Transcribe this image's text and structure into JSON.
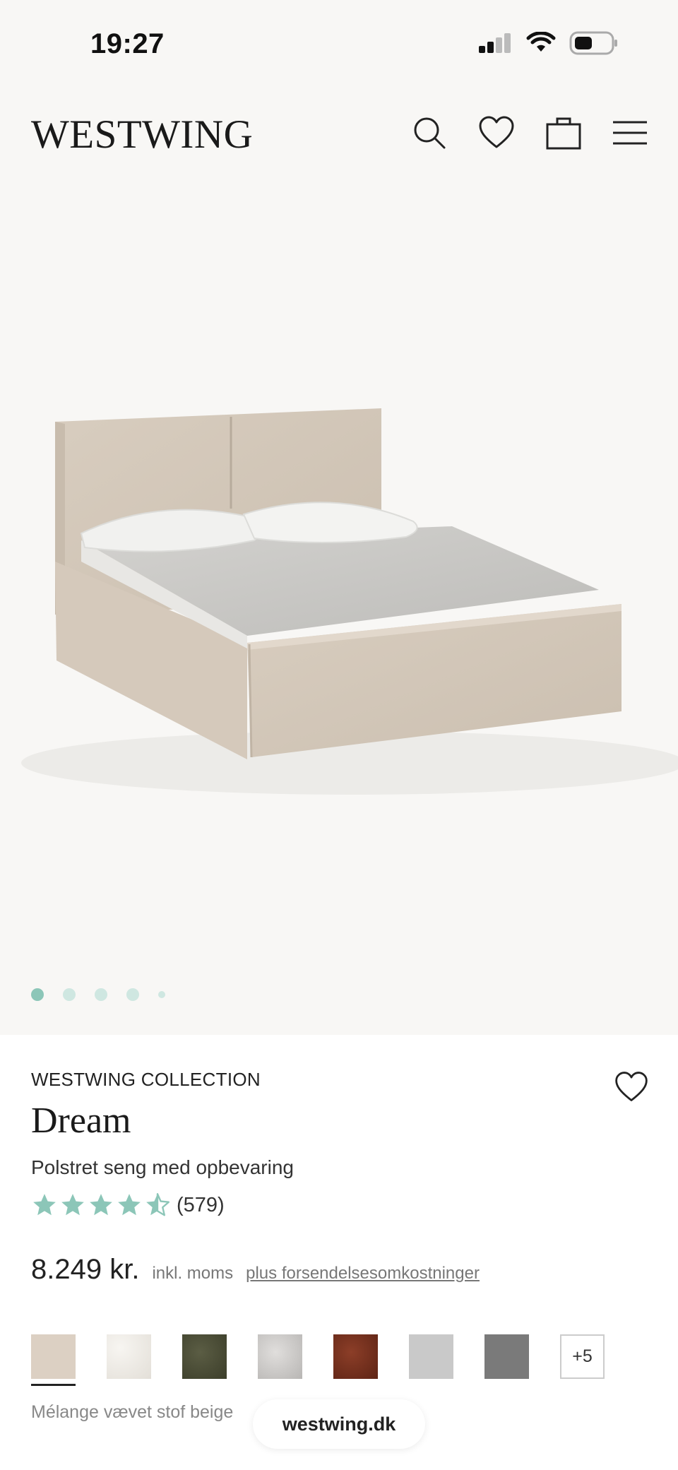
{
  "status": {
    "time": "19:27"
  },
  "header": {
    "logo": "WESTWING"
  },
  "gallery": {
    "dot_count": 5,
    "active_index": 0
  },
  "product": {
    "brand": "WESTWING COLLECTION",
    "name": "Dream",
    "subtitle": "Polstret seng med opbevaring",
    "rating": {
      "stars": 4.5,
      "count": "(579)"
    },
    "price": "8.249 kr.",
    "vat_text": "inkl. moms",
    "shipping_link": "plus forsendelsesomkostninger"
  },
  "swatches": {
    "colors": [
      "#dcd0c3",
      "#ece9e4",
      "#4b4d36",
      "#cfcdcb",
      "#7a3321",
      "#c9c9c9",
      "#7a7a7a"
    ],
    "more_label": "+5",
    "selected_label": "Mélange vævet stof beige"
  },
  "browser": {
    "url": "westwing.dk"
  },
  "colors": {
    "accent": "#8cc6b8",
    "dot_inactive": "#cfe7e1"
  }
}
